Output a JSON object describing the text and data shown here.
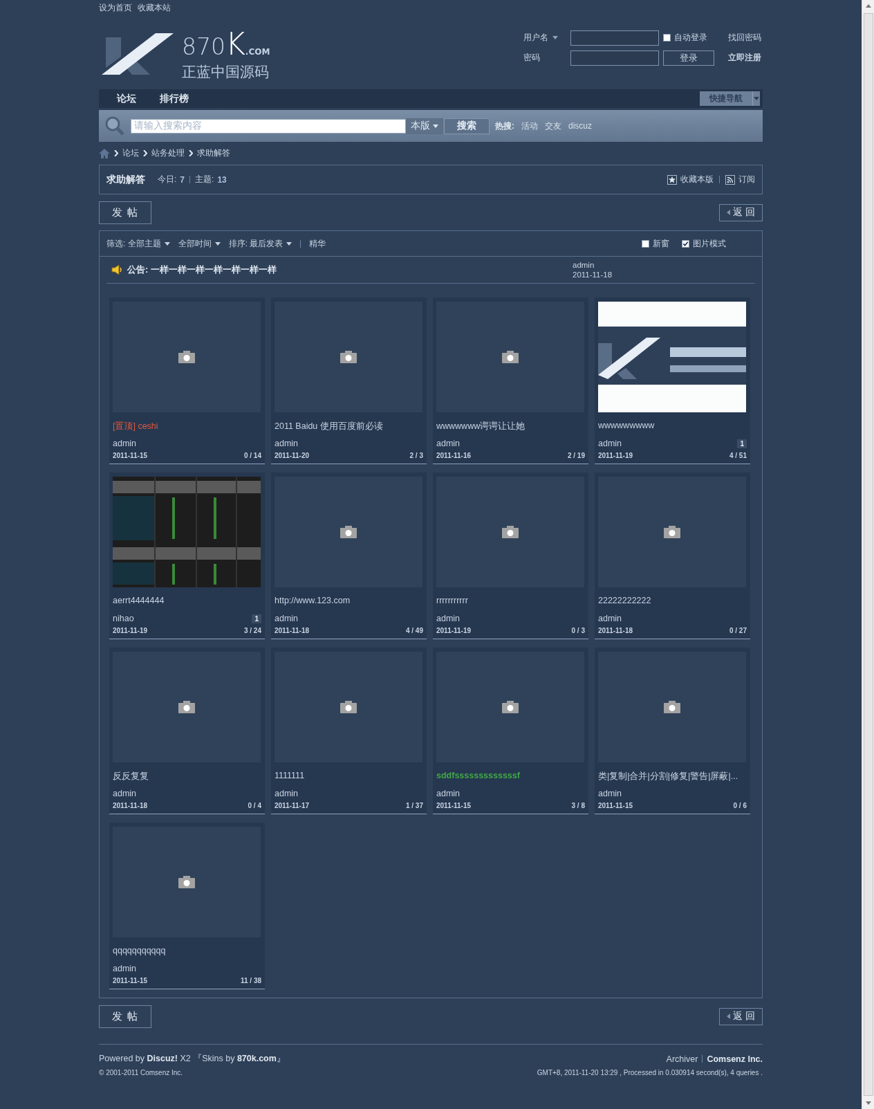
{
  "top_links": [
    "设为首页",
    "收藏本站"
  ],
  "logo": {
    "number": "870",
    "letter": "K",
    "domain": ".COM",
    "tagline": "正蓝中国源码"
  },
  "login": {
    "username_label": "用户名",
    "auto_login": {
      "label": "自动登录",
      "checked": false
    },
    "forgot": "找回密码",
    "password_label": "密码",
    "login_button": "登录",
    "register": "立即注册"
  },
  "nav": {
    "items": [
      "论坛",
      "排行榜"
    ],
    "quick_nav": "快捷导航"
  },
  "search": {
    "placeholder": "请输入搜索内容",
    "scope": "本版",
    "button": "搜索",
    "hot_label": "热搜:",
    "hot": [
      "活动",
      "交友",
      "discuz"
    ]
  },
  "breadcrumb": [
    "论坛",
    "站务处理",
    "求助解答"
  ],
  "forum": {
    "title": "求助解答",
    "today_label": "今日:",
    "today": "7",
    "topics_label": "主题:",
    "topics": "13",
    "favorite": "收藏本版",
    "subscribe": "订阅"
  },
  "actions_top": {
    "post": "发 帖",
    "back": "返 回"
  },
  "filters": {
    "items": [
      "筛选: 全部主题",
      "全部时间",
      "排序: 最后发表"
    ],
    "digest": "精华",
    "options": [
      {
        "label": "新窗",
        "checked": false
      },
      {
        "label": "图片模式",
        "checked": true
      }
    ]
  },
  "announcement": {
    "text": "公告: 一样一样一样一样一样一样一样",
    "author": "admin",
    "date": "2011-11-18"
  },
  "cards": [
    {
      "kind": "placeholder",
      "title": "[置顶] ceshi",
      "color": "#e0583c",
      "bold": false,
      "author": "admin",
      "date": "2011-11-15",
      "stats": "0 / 14"
    },
    {
      "kind": "placeholder",
      "title": "2011 Baidu 使用百度前必读",
      "color": "#c9d4e2",
      "bold": false,
      "author": "admin",
      "date": "2011-11-20",
      "stats": "2 / 3"
    },
    {
      "kind": "placeholder",
      "title": "wwwwwww谔谔让让她",
      "color": "#c9d4e2",
      "bold": false,
      "author": "admin",
      "date": "2011-11-16",
      "stats": "2 / 19"
    },
    {
      "kind": "picture",
      "title": "wwwwwwwww",
      "color": "#c9d4e2",
      "bold": false,
      "author": "admin",
      "badge": "1",
      "date": "2011-11-19",
      "stats": "4 / 51"
    },
    {
      "kind": "picture",
      "title": "aerrt4444444",
      "color": "#c9d4e2",
      "bold": false,
      "author": "nihao",
      "badge": "1",
      "date": "2011-11-19",
      "stats": "3 / 24"
    },
    {
      "kind": "placeholder",
      "title": "http://www.123.com",
      "color": "#c9d4e2",
      "bold": false,
      "author": "admin",
      "date": "2011-11-18",
      "stats": "4 / 49"
    },
    {
      "kind": "placeholder",
      "title": "rrrrrrrrrrr",
      "color": "#c9d4e2",
      "bold": false,
      "author": "admin",
      "date": "2011-11-19",
      "stats": "0 / 3"
    },
    {
      "kind": "placeholder",
      "title": "22222222222",
      "color": "#c9d4e2",
      "bold": false,
      "author": "admin",
      "date": "2011-11-18",
      "stats": "0 / 27"
    },
    {
      "kind": "placeholder",
      "title": "反反复复",
      "color": "#c9d4e2",
      "bold": false,
      "author": "admin",
      "date": "2011-11-18",
      "stats": "0 / 4"
    },
    {
      "kind": "placeholder",
      "title": "1111111",
      "color": "#c9d4e2",
      "bold": false,
      "author": "admin",
      "date": "2011-11-17",
      "stats": "1 / 37"
    },
    {
      "kind": "placeholder",
      "title": "sddfsssssssssssssf",
      "color": "#3fa845",
      "bold": true,
      "author": "admin",
      "date": "2011-11-15",
      "stats": "3 / 8"
    },
    {
      "kind": "placeholder",
      "title": "类|复制|合并|分割|修复|警告|屏蔽|...",
      "color": "#c9d4e2",
      "bold": false,
      "author": "admin",
      "date": "2011-11-15",
      "stats": "0 / 6"
    },
    {
      "kind": "placeholder",
      "title": "qqqqqqqqqqq",
      "color": "#c9d4e2",
      "bold": false,
      "author": "admin",
      "date": "2011-11-15",
      "stats": "11 / 38"
    }
  ],
  "actions_bottom": {
    "post": "发 帖",
    "back": "返 回"
  },
  "footer": {
    "powered": "Powered by **Discuz!** X2 『Skins by **870k.com**』",
    "copyright": "© 2001-2011 Comsenz Inc.",
    "archiver": "Archiver",
    "company": "Comsenz Inc.",
    "info": "GMT+8, 2011-11-20 13:29 , Processed in 0.030914 second(s), 4 queries ."
  }
}
